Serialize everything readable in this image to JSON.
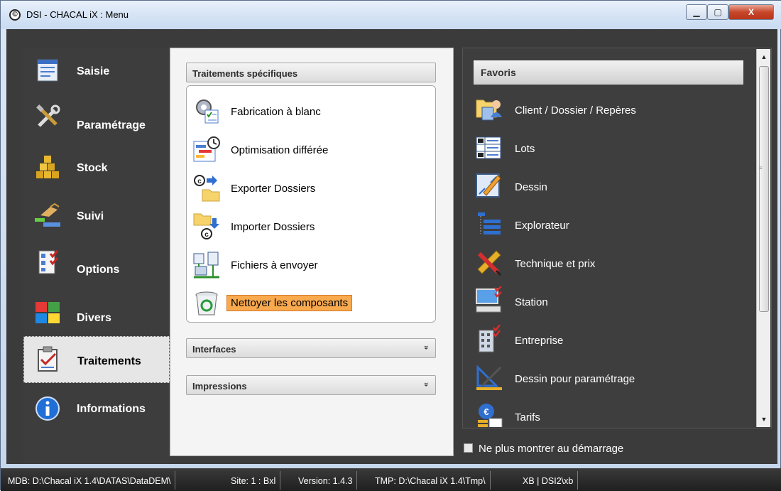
{
  "window": {
    "title": "DSI - CHACAL iX : Menu",
    "app_icon_glyph": "©",
    "min_glyph": "▁",
    "max_glyph": "▢",
    "close_glyph": "X"
  },
  "nav": {
    "items": [
      {
        "label": "Saisie",
        "icon": "form-icon"
      },
      {
        "label": "Paramétrage",
        "icon": "tools-icon"
      },
      {
        "label": "Stock",
        "icon": "stock-blocks-icon"
      },
      {
        "label": "Suivi",
        "icon": "tracking-icon"
      },
      {
        "label": "Options",
        "icon": "options-checklist-icon"
      },
      {
        "label": "Divers",
        "icon": "colored-tiles-icon"
      },
      {
        "label": "Traitements",
        "icon": "clipboard-icon",
        "active": true
      },
      {
        "label": "Informations",
        "icon": "info-icon"
      }
    ]
  },
  "groups": {
    "specific": {
      "title": "Traitements spécifiques",
      "tasks": [
        {
          "label": "Fabrication à blanc",
          "icon": "gear-checklist-icon"
        },
        {
          "label": "Optimisation différée",
          "icon": "clock-schedule-icon"
        },
        {
          "label": "Exporter Dossiers",
          "icon": "export-folder-icon"
        },
        {
          "label": "Importer Dossiers",
          "icon": "import-folder-icon"
        },
        {
          "label": "Fichiers à envoyer",
          "icon": "network-files-icon"
        },
        {
          "label": "Nettoyer les composants",
          "icon": "recycle-bin-icon"
        }
      ]
    },
    "interfaces": {
      "title": "Interfaces",
      "chevron": "»"
    },
    "impressions": {
      "title": "Impressions",
      "chevron": "»"
    }
  },
  "favorites": {
    "title": "Favoris",
    "items": [
      {
        "label": "Client / Dossier / Repères",
        "icon": "client-folder-icon"
      },
      {
        "label": "Lots",
        "icon": "lots-grid-icon"
      },
      {
        "label": "Dessin",
        "icon": "drawing-icon"
      },
      {
        "label": "Explorateur",
        "icon": "explorer-tree-icon"
      },
      {
        "label": "Technique et prix",
        "icon": "pen-ruler-icon"
      },
      {
        "label": "Station",
        "icon": "station-computer-icon"
      },
      {
        "label": "Entreprise",
        "icon": "building-icon"
      },
      {
        "label": "Dessin pour paramétrage",
        "icon": "setsquare-icon"
      },
      {
        "label": "Tarifs",
        "icon": "euro-tariff-icon"
      }
    ],
    "scroll_up": "▲",
    "scroll_down": "▼"
  },
  "startup": {
    "label": "Ne plus montrer au démarrage",
    "checked": false
  },
  "status": {
    "segments": [
      "MDB: D:\\Chacal iX 1.4\\DATAS\\DataDEM\\",
      "Site: 1 : Bxl",
      "Version: 1.4.3",
      "TMP: D:\\Chacal iX 1.4\\Tmp\\",
      "XB | DSI2\\xb"
    ]
  }
}
